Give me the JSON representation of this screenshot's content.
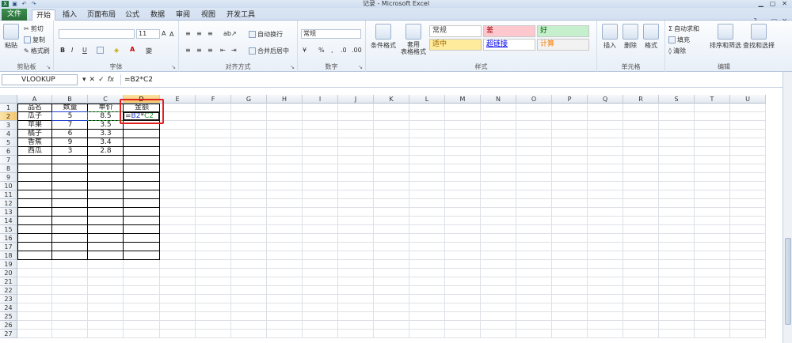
{
  "window": {
    "title": "记录 - Microsoft Excel"
  },
  "tabs": [
    "文件",
    "开始",
    "插入",
    "页面布局",
    "公式",
    "数据",
    "审阅",
    "视图",
    "开发工具"
  ],
  "ribbon": {
    "clipboard": {
      "label": "剪贴板",
      "paste": "粘贴",
      "cut": "剪切",
      "copy": "复制",
      "painter": "格式刷"
    },
    "font": {
      "label": "字体",
      "size": "11",
      "bold": "B",
      "italic": "I",
      "underline": "U"
    },
    "alignment": {
      "label": "对齐方式",
      "wrap": "自动换行",
      "merge": "合并后居中"
    },
    "number": {
      "label": "数字",
      "format": "常规"
    },
    "styles": {
      "label": "样式",
      "cond_format": "条件格式",
      "table_format": "套用\n表格格式",
      "cells": [
        "常规",
        "差",
        "好",
        "适中",
        "超链接",
        "计算"
      ]
    },
    "cells": {
      "label": "单元格",
      "insert": "插入",
      "delete": "删除",
      "format": "格式"
    },
    "editing": {
      "label": "编辑",
      "autosum": "自动求和",
      "fill": "填充",
      "clear": "清除",
      "sort": "排序和筛选",
      "find": "查找和选择"
    }
  },
  "formula_bar": {
    "name_box": "VLOOKUP",
    "formula": "=B2*C2"
  },
  "columns": [
    "A",
    "B",
    "C",
    "D",
    "E",
    "F",
    "G",
    "H",
    "I",
    "J",
    "K",
    "L",
    "M",
    "N",
    "O",
    "P",
    "Q",
    "R",
    "S",
    "T",
    "U"
  ],
  "rows": [
    "1",
    "2",
    "3",
    "4",
    "5",
    "6",
    "7",
    "8",
    "9",
    "10",
    "11",
    "12",
    "13",
    "14",
    "15",
    "16",
    "17",
    "18",
    "19",
    "20",
    "21",
    "22",
    "23",
    "24",
    "25",
    "26",
    "27"
  ],
  "table": {
    "headers": [
      "品名",
      "数量",
      "单价",
      "金额"
    ],
    "rows": [
      [
        "瓜子",
        "5",
        "8.5",
        ""
      ],
      [
        "苹果",
        "7",
        "3.5",
        ""
      ],
      [
        "橘子",
        "6",
        "3.3",
        ""
      ],
      [
        "香蕉",
        "9",
        "3.4",
        ""
      ],
      [
        "西瓜",
        "3",
        "2.8",
        ""
      ]
    ]
  },
  "editing_cell": {
    "ref_b": "B2",
    "op": "*",
    "ref_c": "C2",
    "prefix": "="
  },
  "colors": {
    "accent_red": "#e0201f",
    "ref_blue": "#1f3fd0",
    "ref_green": "#1f9a2f",
    "select_orange": "#f5c76b"
  }
}
